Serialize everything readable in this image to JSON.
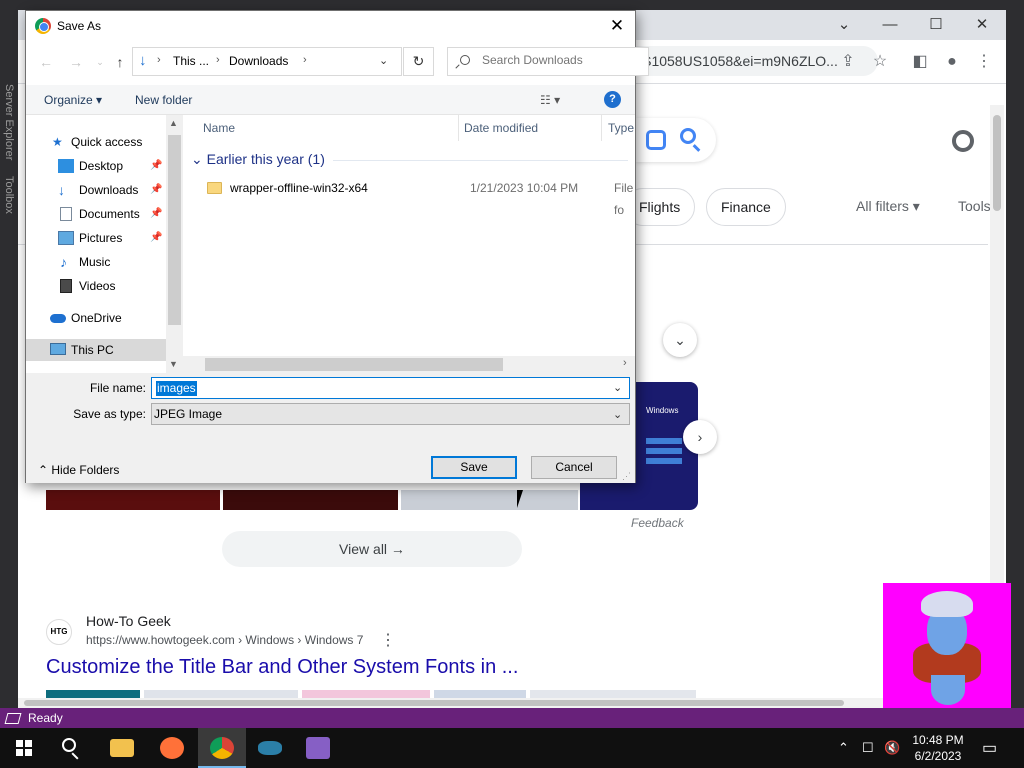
{
  "ide": {
    "side_tabs": [
      "Server Explorer",
      "Toolbox"
    ],
    "status_text": "Ready"
  },
  "browser": {
    "url_text": "US1058US1058&ei=m9N6ZLO...",
    "filter_chips": [
      "Flights",
      "Finance"
    ],
    "all_filters_label": "All filters",
    "tools_label": "Tools",
    "feedback_label": "Feedback",
    "view_all_label": "View all",
    "thumb_text": "Windows",
    "result": {
      "logo_text": "HTG",
      "site_name": "How-To Geek",
      "breadcrumb": "https://www.howtogeek.com › Windows › Windows 7",
      "title": "Customize the Title Bar and Other System Fonts in ..."
    }
  },
  "dialog": {
    "title": "Save As",
    "path": [
      "This ...",
      "Downloads"
    ],
    "search_placeholder": "Search Downloads",
    "organize_label": "Organize",
    "new_folder_label": "New folder",
    "nav_items": [
      {
        "label": "Quick access",
        "icon": "star-icon"
      },
      {
        "label": "Desktop",
        "icon": "desktop-icon",
        "pinned": true
      },
      {
        "label": "Downloads",
        "icon": "download-icon",
        "pinned": true
      },
      {
        "label": "Documents",
        "icon": "documents-icon",
        "pinned": true
      },
      {
        "label": "Pictures",
        "icon": "pictures-icon",
        "pinned": true
      },
      {
        "label": "Music",
        "icon": "music-icon"
      },
      {
        "label": "Videos",
        "icon": "videos-icon"
      },
      {
        "label": "OneDrive",
        "icon": "cloud-icon"
      },
      {
        "label": "This PC",
        "icon": "computer-icon"
      }
    ],
    "columns": [
      "Name",
      "Date modified",
      "Type"
    ],
    "group_header": "Earlier this year (1)",
    "files": [
      {
        "name": "wrapper-offline-win32-x64",
        "date": "1/21/2023 10:04 PM",
        "type": "File fo"
      }
    ],
    "file_name_label": "File name:",
    "file_name_value": "images",
    "save_type_label": "Save as type:",
    "save_type_value": "JPEG Image",
    "hide_folders_label": "Hide Folders",
    "save_label": "Save",
    "cancel_label": "Cancel"
  },
  "taskbar": {
    "time": "10:48 PM",
    "date": "6/2/2023"
  },
  "colors": {
    "ide_status": "#68217a",
    "accent": "#0078d7",
    "link": "#1a0dab",
    "genie_bg": "#ff00ff"
  }
}
